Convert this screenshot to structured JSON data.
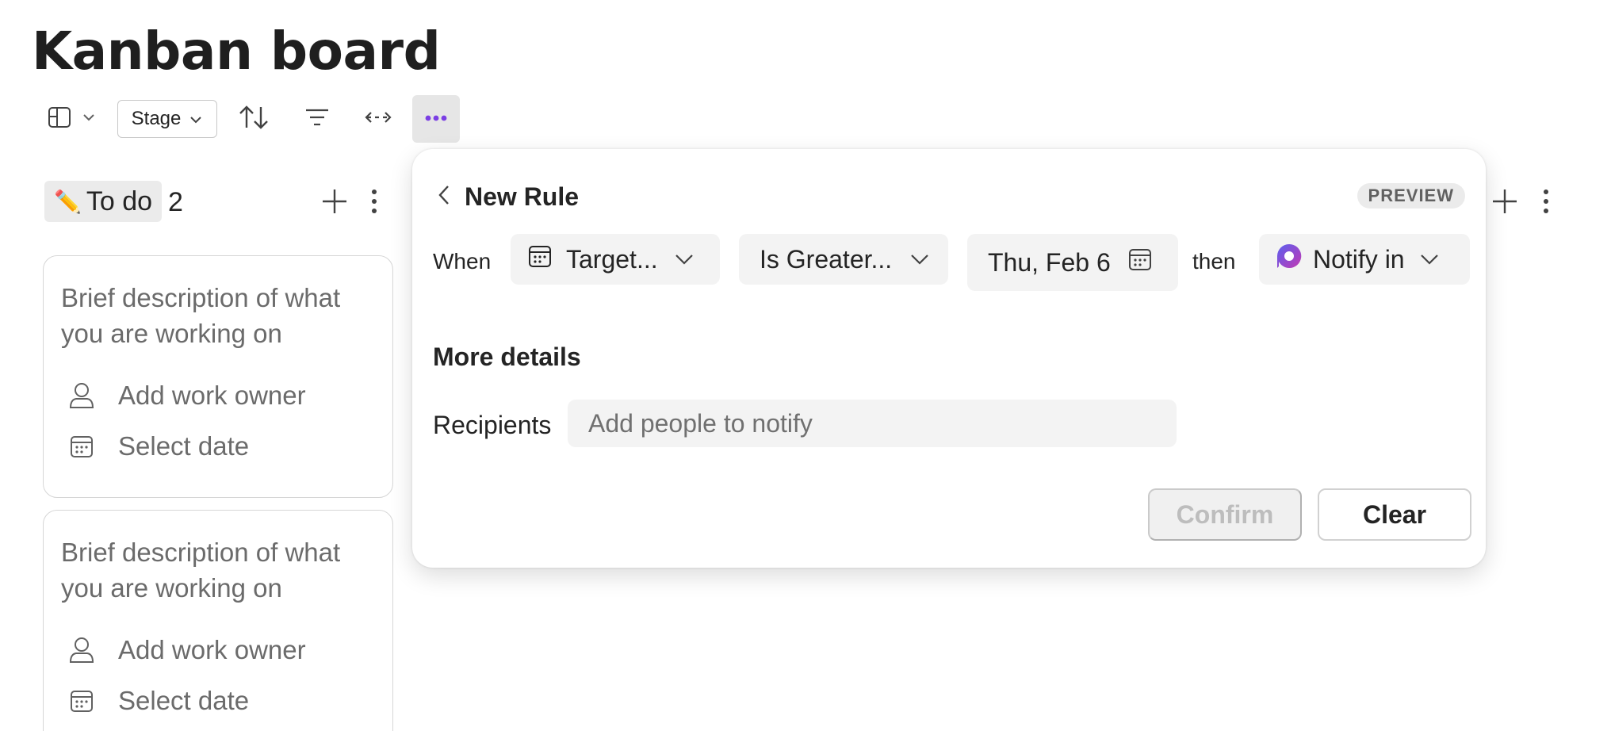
{
  "page": {
    "title": "Kanban board"
  },
  "toolbar": {
    "layout_icon": "board-layout-icon",
    "group_by_label": "Stage",
    "sort_icon": "sort-icon",
    "filter_icon": "filter-icon",
    "expand_icon": "expand-icon",
    "more_icon": "more-icon"
  },
  "column": {
    "emoji": "✏️",
    "name": "To do",
    "count": "2"
  },
  "cards": [
    {
      "description": "Brief description of what you are working on",
      "owner_placeholder": "Add work owner",
      "date_placeholder": "Select date"
    },
    {
      "description": "Brief description of what you are working on",
      "owner_placeholder": "Add work owner",
      "date_placeholder": "Select date"
    }
  ],
  "rule": {
    "title": "New Rule",
    "badge": "PREVIEW",
    "when_label": "When",
    "field": "Target...",
    "operator": "Is Greater...",
    "date": "Thu, Feb 6",
    "then_label": "then",
    "action": "Notify in",
    "more_details": "More details",
    "recipients_label": "Recipients",
    "recipients_placeholder": "Add people to notify",
    "confirm_label": "Confirm",
    "clear_label": "Clear"
  },
  "colors": {
    "accent": "#7b3fe4",
    "loop_gradient_start": "#5b5fef",
    "loop_gradient_end": "#c239b3"
  }
}
